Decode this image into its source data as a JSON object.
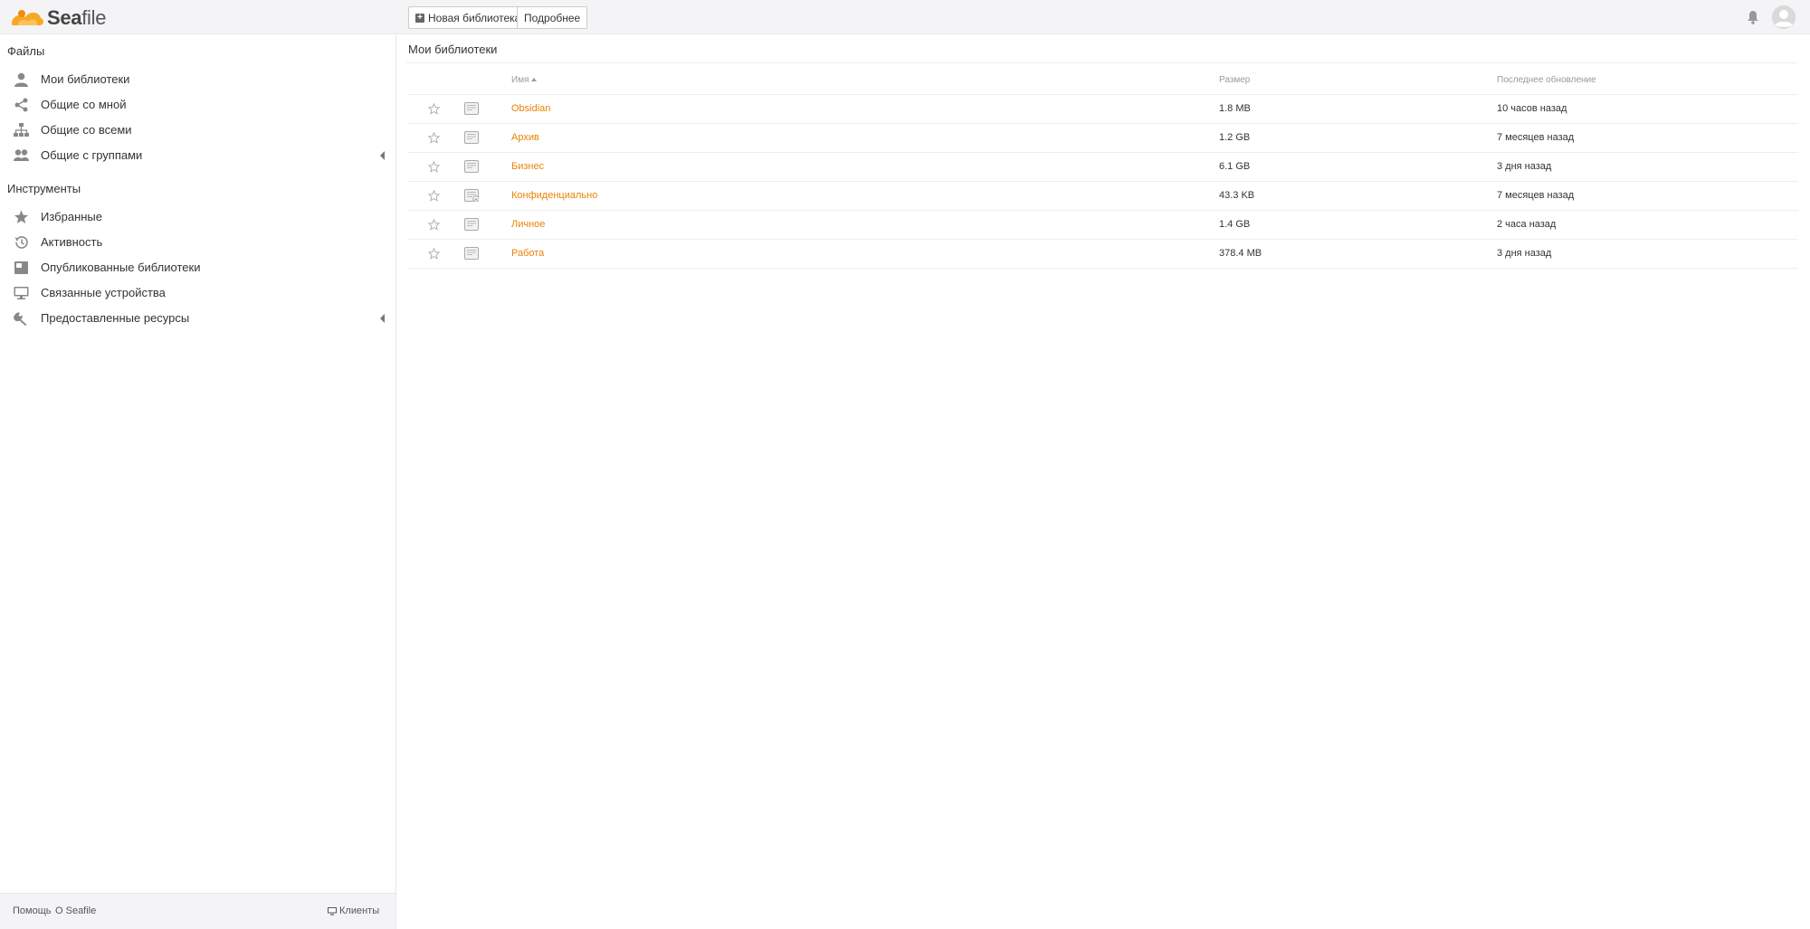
{
  "header": {
    "logo_text_bold": "Sea",
    "logo_text_rest": "file",
    "new_library_label": "Новая библиотека",
    "more_label": "Подробнее"
  },
  "sidebar": {
    "files_heading": "Файлы",
    "files_items": [
      {
        "label": "Мои библиотеки",
        "icon": "user-icon"
      },
      {
        "label": "Общие со мной",
        "icon": "share-icon"
      },
      {
        "label": "Общие со всеми",
        "icon": "org-icon"
      },
      {
        "label": "Общие с группами",
        "icon": "group-icon"
      }
    ],
    "tools_heading": "Инструменты",
    "tools_items": [
      {
        "label": "Избранные",
        "icon": "star-icon"
      },
      {
        "label": "Активность",
        "icon": "history-icon"
      },
      {
        "label": "Опубликованные библиотеки",
        "icon": "wiki-icon"
      },
      {
        "label": "Связанные устройства",
        "icon": "monitor-icon"
      },
      {
        "label": "Предоставленные ресурсы",
        "icon": "wrench-icon"
      }
    ],
    "footer": {
      "help": "Помощь",
      "about": "О Seafile",
      "clients": "Клиенты"
    }
  },
  "main": {
    "title": "Мои библиотеки",
    "columns": {
      "name": "Имя",
      "size": "Размер",
      "updated": "Последнее обновление"
    },
    "libraries": [
      {
        "name": "Obsidian",
        "size": "1.8 MB",
        "updated": "10 часов назад",
        "encrypted": false
      },
      {
        "name": "Архив",
        "size": "1.2 GB",
        "updated": "7 месяцев назад",
        "encrypted": false
      },
      {
        "name": "Бизнес",
        "size": "6.1 GB",
        "updated": "3 дня назад",
        "encrypted": false
      },
      {
        "name": "Конфиденциально",
        "size": "43.3 KB",
        "updated": "7 месяцев назад",
        "encrypted": true
      },
      {
        "name": "Личное",
        "size": "1.4 GB",
        "updated": "2 часа назад",
        "encrypted": false
      },
      {
        "name": "Работа",
        "size": "378.4 MB",
        "updated": "3 дня назад",
        "encrypted": false
      }
    ]
  },
  "colors": {
    "accent": "#eb8205",
    "header_bg": "#f4f4f7",
    "icon_gray": "#888888"
  }
}
